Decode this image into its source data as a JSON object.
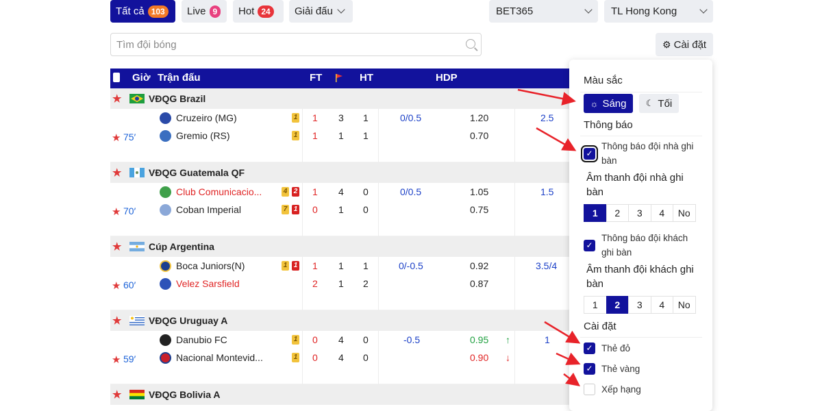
{
  "filters": [
    {
      "label": "Tất cả",
      "count": "103",
      "active": true
    },
    {
      "label": "Live",
      "count": "9"
    },
    {
      "label": "Hot",
      "count": "24"
    },
    {
      "label": "Giải đấu"
    }
  ],
  "bookmaker": "BET365",
  "odds_format": "TL Hong Kong",
  "search": {
    "placeholder": "Tìm đội bóng"
  },
  "settings_button": "Cài đặt",
  "table_header": {
    "time": "Giờ",
    "match": "Trận đấu",
    "ft": "FT",
    "ht": "HT",
    "hdp": "HDP"
  },
  "leagues": [
    {
      "name": "VĐQG Brazil",
      "minute": "75",
      "home": {
        "name": "Cruzeiro (MG)",
        "yellow": "1",
        "red": "",
        "score_ft": "1",
        "corners": "3",
        "score_ht": "1"
      },
      "away": {
        "name": "Gremio (RS)",
        "yellow": "1",
        "red": "",
        "score_ft": "1",
        "corners": "1",
        "score_ht": "1"
      },
      "hdp": "0/0.5",
      "odds_home": "1.20",
      "odds_away": "0.70",
      "ou": "2.5"
    },
    {
      "name": "VĐQG Guatemala QF",
      "minute": "70",
      "home": {
        "name": "Club Comunicacio...",
        "yellow": "4",
        "red": "2",
        "score_ft": "1",
        "corners": "4",
        "score_ht": "0"
      },
      "away": {
        "name": "Coban Imperial",
        "yellow": "7",
        "red": "1",
        "score_ft": "0",
        "corners": "1",
        "score_ht": "0"
      },
      "hdp": "0/0.5",
      "odds_home": "1.05",
      "odds_away": "0.75",
      "ou": "1.5"
    },
    {
      "name": "Cúp Argentina",
      "minute": "60",
      "home": {
        "name": "Boca Juniors(N)",
        "yellow": "1",
        "red": "1",
        "score_ft": "1",
        "corners": "1",
        "score_ht": "1"
      },
      "away": {
        "name": "Velez Sarsfield",
        "yellow": "",
        "red": "",
        "score_ft": "2",
        "corners": "1",
        "score_ht": "2"
      },
      "hdp": "0/-0.5",
      "odds_home": "0.92",
      "odds_away": "0.87",
      "ou": "3.5/4"
    },
    {
      "name": "VĐQG Uruguay A",
      "minute": "59",
      "home": {
        "name": "Danubio FC",
        "yellow": "1",
        "red": "",
        "score_ft": "0",
        "corners": "4",
        "score_ht": "0"
      },
      "away": {
        "name": "Nacional Montevid...",
        "yellow": "1",
        "red": "",
        "score_ft": "0",
        "corners": "4",
        "score_ht": "0"
      },
      "hdp": "-0.5",
      "odds_home": "0.95",
      "odds_away": "0.90",
      "ou": "1"
    },
    {
      "name": "VĐQG Bolivia A"
    }
  ],
  "panel": {
    "color_title": "Màu sắc",
    "light": "Sáng",
    "dark": "Tối",
    "notify_title": "Thông báo",
    "home_notify_1": "Thông báo đội nhà ghi",
    "home_notify_2": "bàn",
    "home_sound_1": "Âm thanh đội nhà ghi",
    "home_sound_2": "bàn",
    "home_sound_options": [
      "1",
      "2",
      "3",
      "4",
      "No"
    ],
    "away_notify_1": "Thông báo đội khách",
    "away_notify_2": "ghi bàn",
    "away_sound_1": "Âm thanh đội khách ghi",
    "away_sound_2": "bàn",
    "away_sound_options": [
      "1",
      "2",
      "3",
      "4",
      "No"
    ],
    "settings_title": "Cài đặt",
    "red_card": "Thẻ đỏ",
    "yellow_card": "Thẻ vàng",
    "ranking": "Xếp hạng"
  },
  "colors": {
    "primary": "#12129c",
    "accent_red": "#e02424",
    "minute_blue": "#1d63d8"
  }
}
